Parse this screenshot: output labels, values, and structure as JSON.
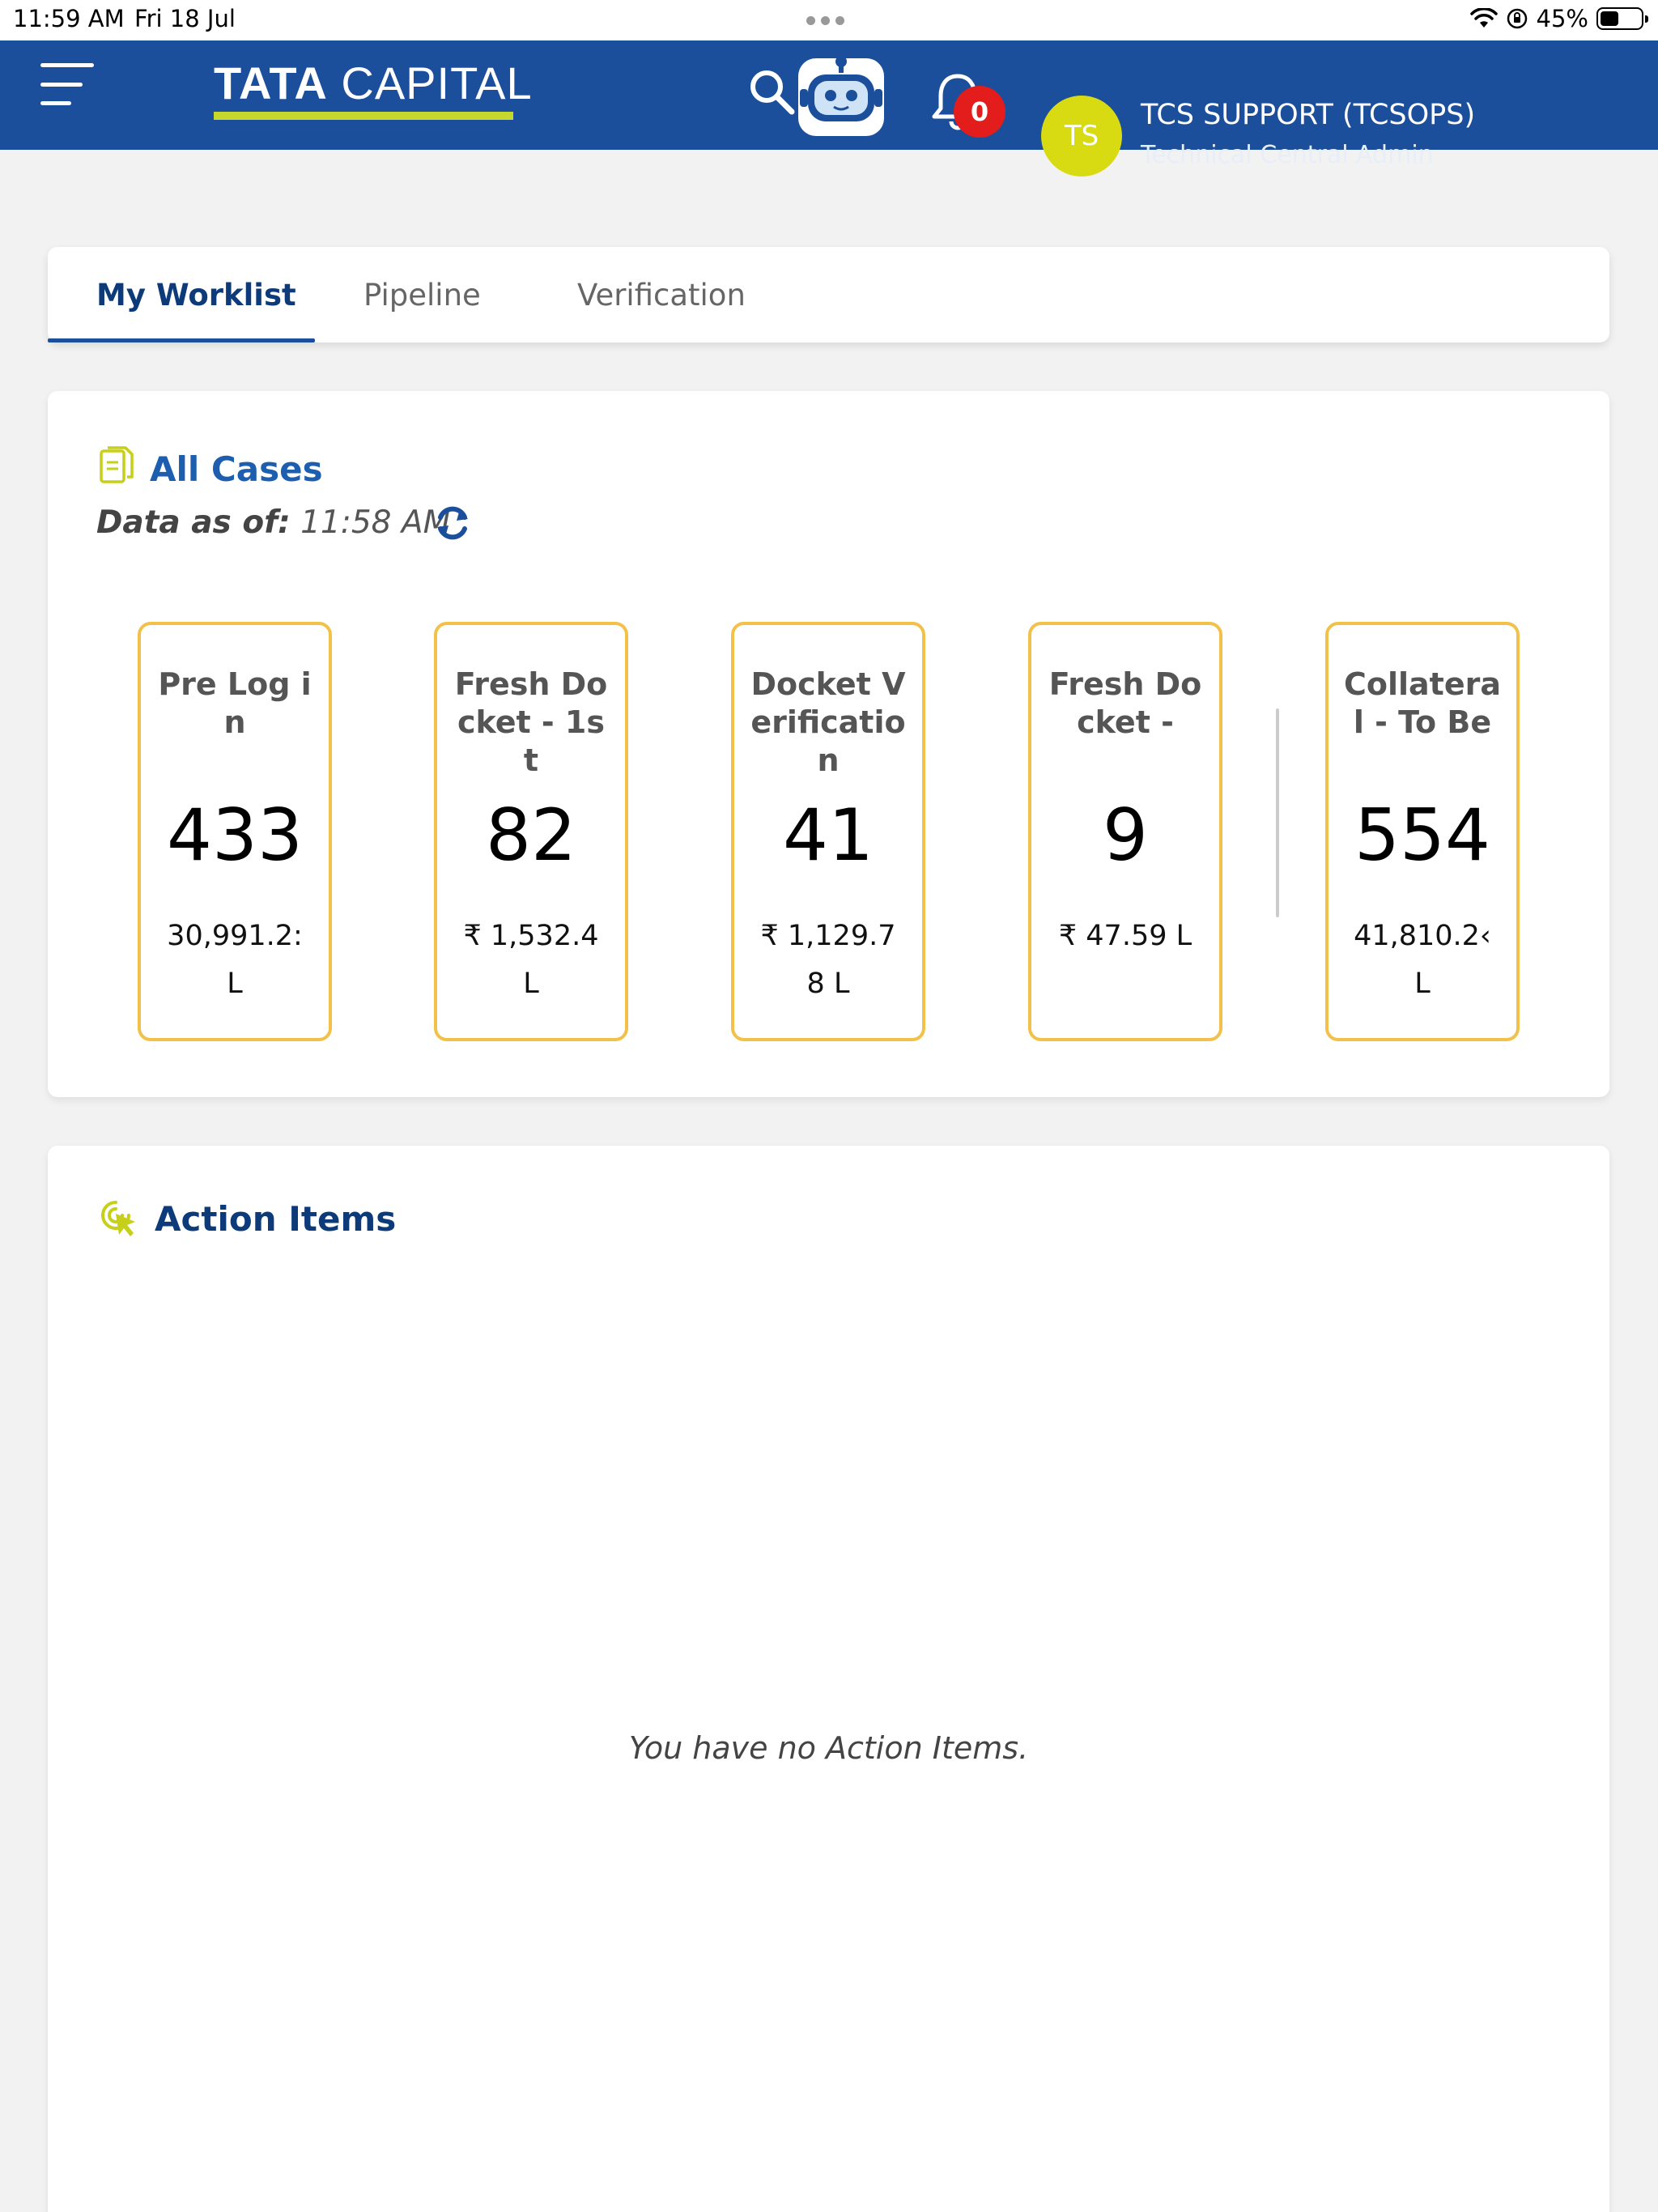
{
  "status_bar": {
    "time": "11:59 AM",
    "date": "Fri 18 Jul",
    "battery": "45%",
    "battery_level": 0.45
  },
  "header": {
    "brand_word1": "TATA",
    "brand_word2": " CAPITAL",
    "notification_count": "0",
    "avatar_initials": "TS",
    "user_name": "TCS SUPPORT (TCSOPS)",
    "user_role": "Technical Central Admin",
    "colors": {
      "bar": "#1b4f9c",
      "avatar": "#d8db12",
      "badge": "#e31c1c",
      "brand_accent": "#c6d82e"
    }
  },
  "tabs": [
    {
      "label": "My Worklist",
      "active": true
    },
    {
      "label": "Pipeline",
      "active": false
    },
    {
      "label": "Verification",
      "active": false
    }
  ],
  "all_cases": {
    "title": "All Cases",
    "data_as_of_label": "Data as of:",
    "data_as_of_time": " 11:58 AM",
    "cards": [
      {
        "label": "Pre Log in",
        "count": "433",
        "amount": "30,991.2: L"
      },
      {
        "label": "Fresh Docket - 1st",
        "count": "82",
        "amount": "₹ 1,532.4 L"
      },
      {
        "label": "Docket Verification",
        "count": "41",
        "amount": "₹ 1,129.78 L"
      },
      {
        "label": "Fresh Docket -",
        "count": "9",
        "amount": "₹ 47.59 L"
      },
      {
        "label": "Collateral - To Be",
        "count": "554",
        "amount": "41,810.2‹ L"
      }
    ]
  },
  "action_items": {
    "title": "Action Items",
    "empty_message": "You have no Action Items."
  },
  "icons": {
    "menu": "hamburger-menu-icon",
    "search": "search-icon",
    "bot": "chatbot-icon",
    "notifications": "bell-icon",
    "cases": "document-icon",
    "refresh": "refresh-icon",
    "actions": "cursor-click-icon"
  }
}
